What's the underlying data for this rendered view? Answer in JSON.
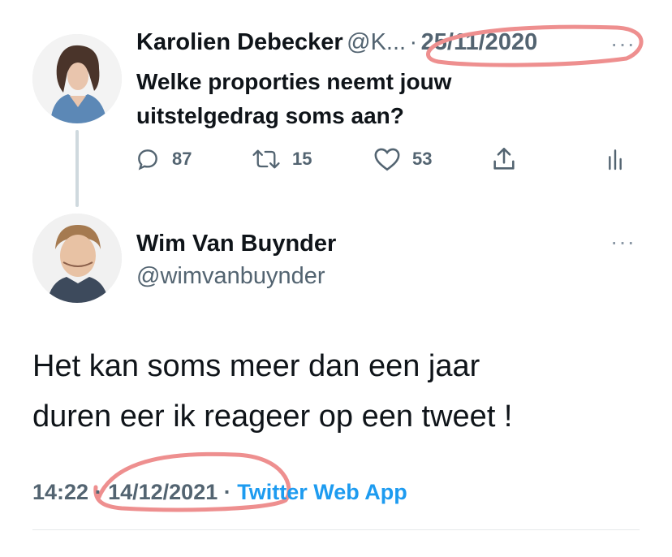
{
  "quoted_tweet": {
    "author_name": "Karolien Debecker",
    "author_handle": "@K...",
    "separator": "·",
    "date": "25/11/2020",
    "more": "···",
    "text_line1": "Welke proporties neemt jouw",
    "text_line2": "uitstelgedrag soms aan?",
    "replies": "87",
    "retweets": "15",
    "likes": "53"
  },
  "reply_tweet": {
    "author_name": "Wim Van Buynder",
    "author_handle": "@wimvanbuynder",
    "more": "···",
    "text_line1": "Het kan soms meer dan een jaar",
    "text_line2": "duren eer ik reageer op een tweet !",
    "time": "14:22",
    "date": "14/12/2021",
    "source": "Twitter Web App",
    "sep1": "·",
    "sep2": "·"
  },
  "colors": {
    "annotation": "#ee8f8f",
    "link": "#1d9bf0",
    "secondary": "#536471"
  }
}
